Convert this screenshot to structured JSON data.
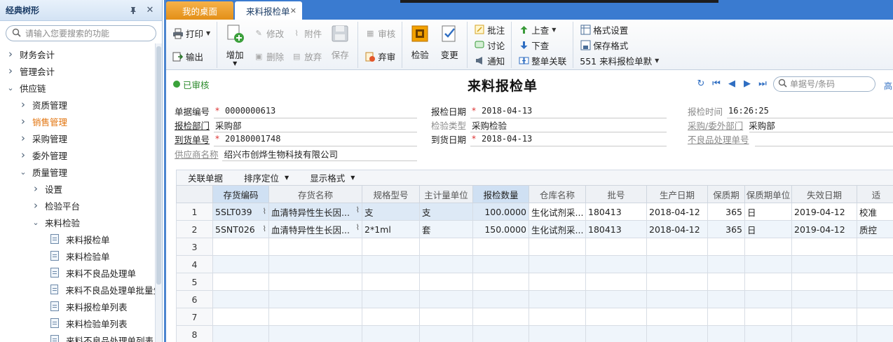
{
  "left": {
    "title": "经典树形",
    "search_placeholder": "请输入您要搜索的功能",
    "tree": [
      {
        "label": "财务会计",
        "depth": 0,
        "state": "collapsed"
      },
      {
        "label": "管理会计",
        "depth": 0,
        "state": "collapsed"
      },
      {
        "label": "供应链",
        "depth": 0,
        "state": "expanded"
      },
      {
        "label": "资质管理",
        "depth": 1,
        "state": "collapsed"
      },
      {
        "label": "销售管理",
        "depth": 1,
        "state": "collapsed",
        "active": true
      },
      {
        "label": "采购管理",
        "depth": 1,
        "state": "collapsed"
      },
      {
        "label": "委外管理",
        "depth": 1,
        "state": "collapsed"
      },
      {
        "label": "质量管理",
        "depth": 1,
        "state": "expanded"
      },
      {
        "label": "设置",
        "depth": 2,
        "state": "collapsed"
      },
      {
        "label": "检验平台",
        "depth": 2,
        "state": "collapsed"
      },
      {
        "label": "来料检验",
        "depth": 2,
        "state": "expanded"
      },
      {
        "label": "来料报检单",
        "depth": 3,
        "state": "leaf"
      },
      {
        "label": "来料检验单",
        "depth": 3,
        "state": "leaf"
      },
      {
        "label": "来料不良品处理单",
        "depth": 3,
        "state": "leaf"
      },
      {
        "label": "来料不良品处理单批量生",
        "depth": 3,
        "state": "leaf"
      },
      {
        "label": "来料报检单列表",
        "depth": 3,
        "state": "leaf"
      },
      {
        "label": "来料检验单列表",
        "depth": 3,
        "state": "leaf"
      },
      {
        "label": "来料不良品处理单列表",
        "depth": 3,
        "state": "leaf"
      }
    ]
  },
  "tabs": {
    "home": "我的桌面",
    "current": "来料报检单"
  },
  "ribbon": {
    "print": "打印",
    "export": "输出",
    "add": "增加",
    "edit": "修改",
    "attach": "附件",
    "delete": "删除",
    "abandon": "放弃",
    "save": "保存",
    "audit": "审核",
    "discard": "弃审",
    "inspect": "检验",
    "change": "变更",
    "annotate": "批注",
    "discuss": "讨论",
    "notify": "通知",
    "prev": "上查",
    "next": "下查",
    "link_all": "整单关联",
    "format_settings": "格式设置",
    "save_format": "保存格式",
    "template": "551 来料报检单默"
  },
  "doc": {
    "status": "已审核",
    "title": "来料报检单",
    "search_placeholder": "单据号/条码",
    "more": "高"
  },
  "form": {
    "doc_no_label": "单据编号",
    "doc_no": "0000000613",
    "inspect_date_label": "报检日期",
    "inspect_date": "2018-04-13",
    "inspect_time_label": "报检时间",
    "inspect_time": "16:26:25",
    "dept_label": "报检部门",
    "dept": "采购部",
    "type_label": "检验类型",
    "type": "采购检验",
    "pur_dept_label": "采购/委外部门",
    "pur_dept": "采购部",
    "arrival_no_label": "到货单号",
    "arrival_no": "20180001748",
    "arrival_date_label": "到货日期",
    "arrival_date": "2018-04-13",
    "bad_no_label": "不良品处理单号",
    "bad_no": "",
    "supplier_label": "供应商名称",
    "supplier": "绍兴市创烨生物科技有限公司"
  },
  "grid": {
    "toolbar": {
      "link": "关联单据",
      "sort": "排序定位",
      "display": "显示格式"
    },
    "columns": [
      "存货编码",
      "存货名称",
      "规格型号",
      "主计量单位",
      "报检数量",
      "仓库名称",
      "批号",
      "生产日期",
      "保质期",
      "保质期单位",
      "失效日期",
      "适"
    ],
    "rows": [
      {
        "n": "1",
        "code": "5SLT039",
        "name": "血清特异性生长因...",
        "spec": "支",
        "unit": "支",
        "qty": "100.0000",
        "wh": "生化试剂采...",
        "lot": "180413",
        "mfg": "2018-04-12",
        "shelf": "365",
        "shelf_unit": "日",
        "exp": "2019-04-12",
        "extra": "校准"
      },
      {
        "n": "2",
        "code": "5SNT026",
        "name": "血清特异性生长因...",
        "spec": "2*1ml",
        "unit": "套",
        "qty": "150.0000",
        "wh": "生化试剂采...",
        "lot": "180413",
        "mfg": "2018-04-12",
        "shelf": "365",
        "shelf_unit": "日",
        "exp": "2019-04-12",
        "extra": "质控"
      }
    ],
    "empty_rows": [
      "3",
      "4",
      "5",
      "6",
      "7",
      "8"
    ]
  }
}
